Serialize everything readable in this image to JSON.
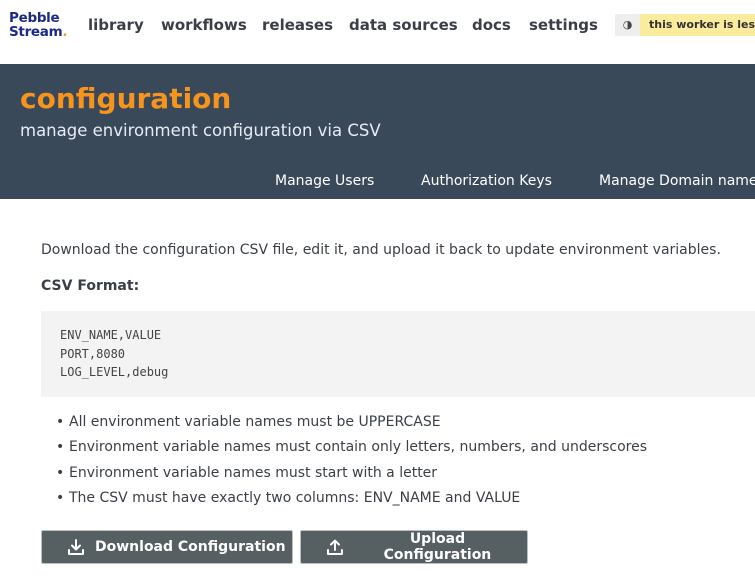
{
  "brand": {
    "line1": "Pebble",
    "line2": "Stream",
    "dot": "."
  },
  "nav": {
    "items": [
      "library",
      "workflows",
      "releases",
      "data sources",
      "docs",
      "settings"
    ],
    "theme_toggle_icon": "contrast-icon",
    "worker_banner": "this worker is less"
  },
  "header": {
    "title": "configuration",
    "subtitle": "manage environment configuration via CSV",
    "subnav": [
      "Manage Users",
      "Authorization Keys",
      "Manage Domain name"
    ]
  },
  "content": {
    "intro": "Download the configuration CSV file, edit it, and upload it back to update environment variables.",
    "csv_heading": "CSV Format:",
    "csv_lines": [
      "ENV_NAME,VALUE",
      "PORT,8080",
      "LOG_LEVEL,debug"
    ],
    "rules": [
      "All environment variable names must be UPPERCASE",
      "Environment variable names must contain only letters, numbers, and underscores",
      "Environment variable names must start with a letter",
      "The CSV must have exactly two columns: ENV_NAME and VALUE"
    ],
    "download_label": "Download Configuration",
    "upload_label": "Upload Configuration"
  },
  "colors": {
    "header_bg": "#39495a",
    "accent": "#f7941d",
    "button_bg": "#565f62",
    "banner_bg": "#fbeb9d"
  }
}
